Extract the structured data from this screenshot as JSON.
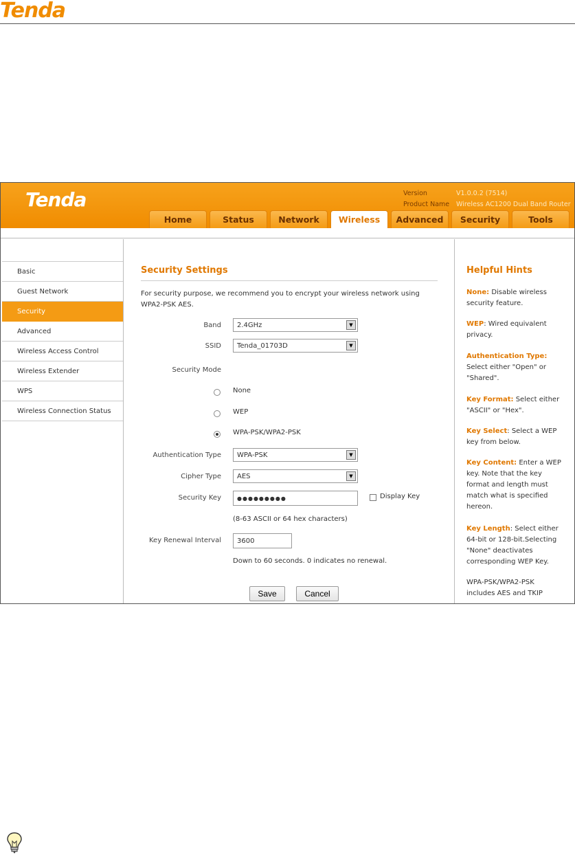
{
  "doc": {
    "logo": "Tenda"
  },
  "app": {
    "brand": "Tenda",
    "version_label": "Version",
    "version_value": "V1.0.0.2 (7514)",
    "product_label": "Product Name",
    "product_value": "Wireless AC1200 Dual Band Router"
  },
  "tabs": [
    {
      "label": "Home"
    },
    {
      "label": "Status"
    },
    {
      "label": "Network"
    },
    {
      "label": "Wireless",
      "active": true
    },
    {
      "label": "Advanced"
    },
    {
      "label": "Security"
    },
    {
      "label": "Tools"
    }
  ],
  "sidebar": {
    "items": [
      {
        "label": "Basic"
      },
      {
        "label": "Guest Network"
      },
      {
        "label": "Security",
        "active": true
      },
      {
        "label": "Advanced"
      },
      {
        "label": "Wireless Access Control"
      },
      {
        "label": "Wireless Extender"
      },
      {
        "label": "WPS"
      },
      {
        "label": "Wireless Connection Status"
      }
    ]
  },
  "main": {
    "title": "Security Settings",
    "intro": "For security purpose, we recommend you to encrypt your wireless network using WPA2-PSK AES.",
    "band_label": "Band",
    "band_value": "2.4GHz",
    "ssid_label": "SSID",
    "ssid_value": "Tenda_01703D",
    "mode_label": "Security Mode",
    "modes": [
      {
        "label": "None",
        "selected": false
      },
      {
        "label": "WEP",
        "selected": false
      },
      {
        "label": "WPA-PSK/WPA2-PSK",
        "selected": true
      }
    ],
    "auth_label": "Authentication Type",
    "auth_value": "WPA-PSK",
    "cipher_label": "Cipher Type",
    "cipher_value": "AES",
    "key_label": "Security Key",
    "key_value": "●●●●●●●●●",
    "display_key_label": "Display Key",
    "key_hint": "(8-63 ASCII or 64 hex characters)",
    "renewal_label": "Key Renewal Interval",
    "renewal_value": "3600",
    "renewal_hint": "Down to 60 seconds. 0 indicates no renewal.",
    "save_label": "Save",
    "cancel_label": "Cancel"
  },
  "hints": {
    "title": "Helpful Hints",
    "items": [
      {
        "term": "None:",
        "text": " Disable wireless security feature."
      },
      {
        "term": "WEP",
        "text": ": Wired equivalent privacy."
      },
      {
        "term": "Authentication Type:",
        "text": " Select either \"Open\" or \"Shared\"."
      },
      {
        "term": "Key Format:",
        "text": " Select either \"ASCII\" or \"Hex\"."
      },
      {
        "term": "Key Select",
        "text": ": Select a WEP key from below."
      },
      {
        "term": "Key Content:",
        "text": " Enter a WEP key. Note that the key format and length must match what is specified hereon."
      },
      {
        "term": "Key Length",
        "text": ": Select either 64-bit or 128-bit.Selecting \"None\" deactivates corresponding WEP Key."
      },
      {
        "term": "",
        "text": "WPA-PSK/WPA2-PSK includes AES and TKIP"
      }
    ]
  }
}
